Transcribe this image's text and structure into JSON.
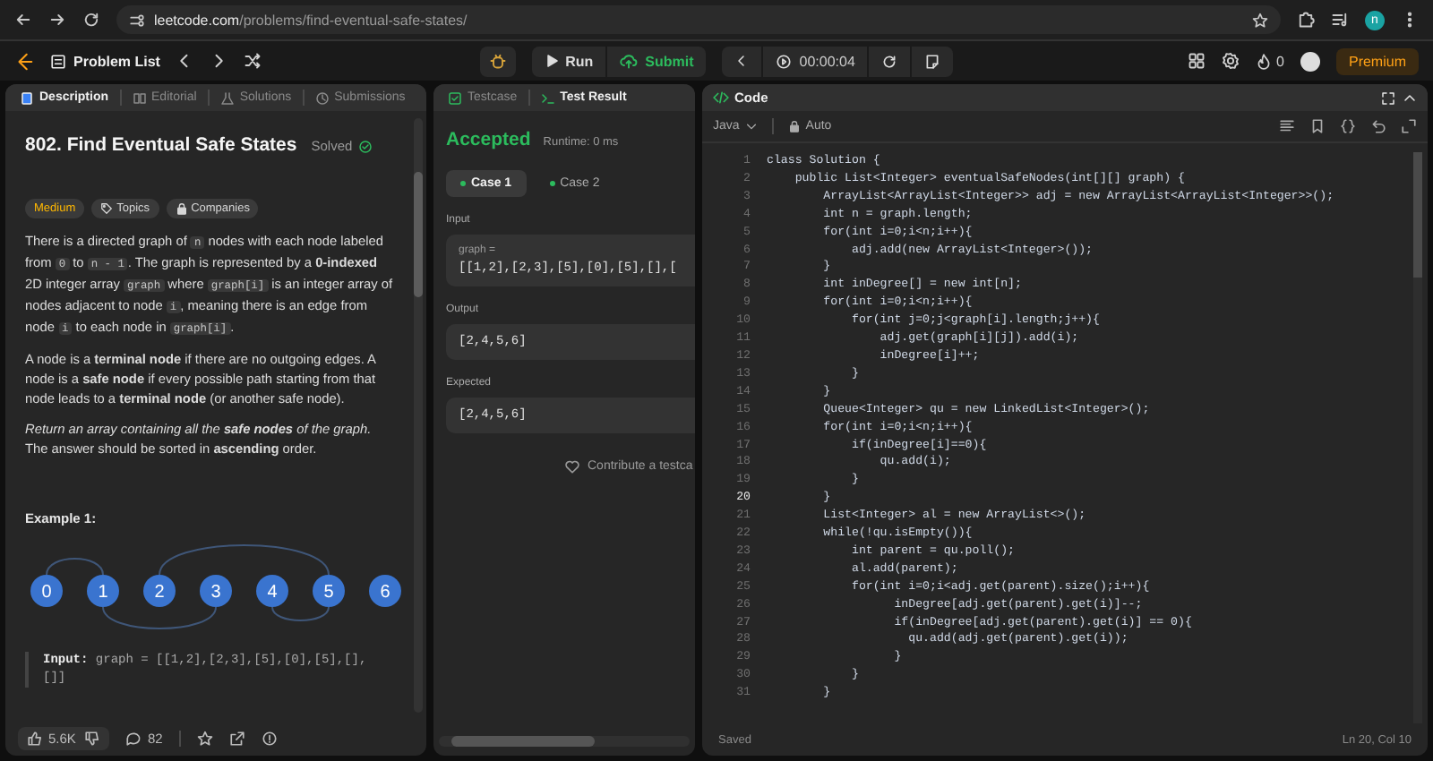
{
  "browser": {
    "url_domain": "leetcode.com",
    "url_path": "/problems/find-eventual-safe-states/",
    "profile_initial": "n"
  },
  "navbar": {
    "problem_list": "Problem List",
    "run": "Run",
    "submit": "Submit",
    "timer": "00:00:04",
    "streak": "0",
    "premium": "Premium"
  },
  "description_panel": {
    "tabs": [
      {
        "label": "Description",
        "selected": true
      },
      {
        "label": "Editorial",
        "selected": false
      },
      {
        "label": "Solutions",
        "selected": false
      },
      {
        "label": "Submissions",
        "selected": false
      }
    ],
    "title": "802. Find Eventual Safe States",
    "status": "Solved",
    "tags": [
      {
        "label": "Medium",
        "kind": "difficulty"
      },
      {
        "label": "Topics",
        "kind": "topics"
      },
      {
        "label": "Companies",
        "kind": "companies"
      }
    ],
    "paragraphs": [
      [
        {
          "text": "There is a directed graph of ",
          "kind": "plain"
        },
        {
          "text": "n",
          "kind": "code"
        },
        {
          "text": " nodes with each node labeled from ",
          "kind": "plain"
        },
        {
          "text": "0",
          "kind": "code"
        },
        {
          "text": " to ",
          "kind": "plain"
        },
        {
          "text": "n - 1",
          "kind": "code"
        },
        {
          "text": ". The graph is represented by a ",
          "kind": "plain"
        },
        {
          "text": "0-indexed",
          "kind": "bold"
        },
        {
          "text": " 2D integer array ",
          "kind": "plain"
        },
        {
          "text": "graph",
          "kind": "code"
        },
        {
          "text": " where ",
          "kind": "plain"
        },
        {
          "text": "graph[i]",
          "kind": "code"
        },
        {
          "text": " is an integer array of nodes adjacent to node ",
          "kind": "plain"
        },
        {
          "text": "i",
          "kind": "code"
        },
        {
          "text": ", meaning there is an edge from node ",
          "kind": "plain"
        },
        {
          "text": "i",
          "kind": "code"
        },
        {
          "text": " to each node in ",
          "kind": "plain"
        },
        {
          "text": "graph[i]",
          "kind": "code"
        },
        {
          "text": ".",
          "kind": "plain"
        }
      ],
      [
        {
          "text": "A node is a ",
          "kind": "plain"
        },
        {
          "text": "terminal node",
          "kind": "bold"
        },
        {
          "text": " if there are no outgoing edges. A node is a ",
          "kind": "plain"
        },
        {
          "text": "safe node",
          "kind": "bold"
        },
        {
          "text": " if every possible path starting from that node leads to a ",
          "kind": "plain"
        },
        {
          "text": "terminal node",
          "kind": "bold"
        },
        {
          "text": " (or another safe node).",
          "kind": "plain"
        }
      ],
      [
        {
          "text": "Return an array containing all the ",
          "kind": "italic"
        },
        {
          "text": "safe nodes",
          "kind": "bolditalic"
        },
        {
          "text": " of the graph.",
          "kind": "italic"
        },
        {
          "text": " The answer should be sorted in ",
          "kind": "plain"
        },
        {
          "text": "ascending",
          "kind": "bold"
        },
        {
          "text": " order.",
          "kind": "plain"
        }
      ]
    ],
    "example_title": "Example 1:",
    "graph_nodes": [
      "0",
      "1",
      "2",
      "3",
      "4",
      "5",
      "6"
    ],
    "example_input": [
      {
        "text": "Input:",
        "kind": "bold"
      },
      {
        "text": " graph = [[1,2],[2,3],[5],[0],[5],[],[]]",
        "kind": "plain"
      }
    ],
    "likes": "5.6K",
    "comments": "82"
  },
  "result_panel": {
    "tabs": [
      {
        "label": "Testcase",
        "selected": false
      },
      {
        "label": "Test Result",
        "selected": true
      }
    ],
    "verdict": "Accepted",
    "runtime": "Runtime: 0 ms",
    "cases": [
      {
        "label": "Case 1",
        "selected": true
      },
      {
        "label": "Case 2",
        "selected": false
      }
    ],
    "input_label": "Input",
    "input_var": "graph =",
    "input_value": "[[1,2],[2,3],[5],[0],[5],[],[",
    "output_label": "Output",
    "output_value": "[2,4,5,6]",
    "expected_label": "Expected",
    "expected_value": "[2,4,5,6]",
    "contribute": "Contribute a testca"
  },
  "code_panel": {
    "title": "Code",
    "language": "Java",
    "mode": "Auto",
    "lines": [
      {
        "no": "1",
        "text": "class Solution {",
        "current": false
      },
      {
        "no": "2",
        "text": "    public List<Integer> eventualSafeNodes(int[][] graph) {",
        "current": false
      },
      {
        "no": "3",
        "text": "        ArrayList<ArrayList<Integer>> adj = new ArrayList<ArrayList<Integer>>();",
        "current": false
      },
      {
        "no": "4",
        "text": "        int n = graph.length;",
        "current": false
      },
      {
        "no": "5",
        "text": "        for(int i=0;i<n;i++){",
        "current": false
      },
      {
        "no": "6",
        "text": "            adj.add(new ArrayList<Integer>());",
        "current": false
      },
      {
        "no": "7",
        "text": "        }",
        "current": false
      },
      {
        "no": "8",
        "text": "        int inDegree[] = new int[n];",
        "current": false
      },
      {
        "no": "9",
        "text": "        for(int i=0;i<n;i++){",
        "current": false
      },
      {
        "no": "10",
        "text": "            for(int j=0;j<graph[i].length;j++){",
        "current": false
      },
      {
        "no": "11",
        "text": "                adj.get(graph[i][j]).add(i);",
        "current": false
      },
      {
        "no": "12",
        "text": "                inDegree[i]++;",
        "current": false
      },
      {
        "no": "13",
        "text": "            }",
        "current": false
      },
      {
        "no": "14",
        "text": "        }",
        "current": false
      },
      {
        "no": "15",
        "text": "        Queue<Integer> qu = new LinkedList<Integer>();",
        "current": false
      },
      {
        "no": "16",
        "text": "        for(int i=0;i<n;i++){",
        "current": false
      },
      {
        "no": "17",
        "text": "            if(inDegree[i]==0){",
        "current": false
      },
      {
        "no": "18",
        "text": "                qu.add(i);",
        "current": false
      },
      {
        "no": "19",
        "text": "            }",
        "current": false
      },
      {
        "no": "20",
        "text": "        }",
        "current": true
      },
      {
        "no": "21",
        "text": "        List<Integer> al = new ArrayList<>();",
        "current": false
      },
      {
        "no": "22",
        "text": "        while(!qu.isEmpty()){",
        "current": false
      },
      {
        "no": "23",
        "text": "            int parent = qu.poll();",
        "current": false
      },
      {
        "no": "24",
        "text": "            al.add(parent);",
        "current": false
      },
      {
        "no": "25",
        "text": "            for(int i=0;i<adj.get(parent).size();i++){",
        "current": false
      },
      {
        "no": "26",
        "text": "                  inDegree[adj.get(parent).get(i)]--;",
        "current": false
      },
      {
        "no": "27",
        "text": "                  if(inDegree[adj.get(parent).get(i)] == 0){",
        "current": false
      },
      {
        "no": "28",
        "text": "                    qu.add(adj.get(parent).get(i));",
        "current": false
      },
      {
        "no": "29",
        "text": "                  }",
        "current": false
      },
      {
        "no": "30",
        "text": "            }",
        "current": false
      },
      {
        "no": "31",
        "text": "        }",
        "current": false
      }
    ],
    "status": "Saved",
    "cursor": "Ln 20, Col 10"
  }
}
